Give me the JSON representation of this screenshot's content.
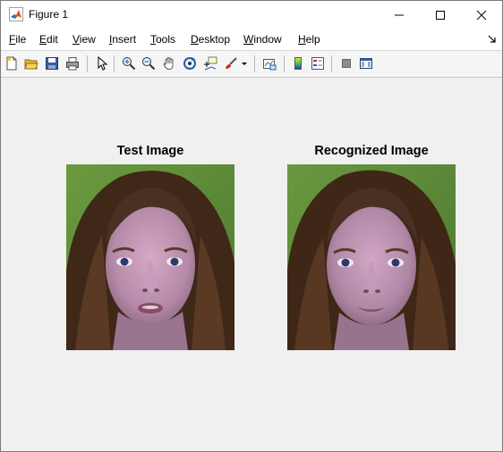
{
  "window": {
    "title": "Figure 1",
    "controls": [
      "minimize",
      "maximize",
      "close"
    ]
  },
  "menubar": {
    "items": [
      "File",
      "Edit",
      "View",
      "Insert",
      "Tools",
      "Desktop",
      "Window",
      "Help"
    ]
  },
  "toolbar": {
    "buttons": [
      {
        "icon": "new-figure-icon"
      },
      {
        "icon": "open-file-icon"
      },
      {
        "icon": "save-icon"
      },
      {
        "icon": "print-icon"
      },
      {
        "icon": "edit-plot-arrow-icon"
      },
      {
        "icon": "zoom-in-icon"
      },
      {
        "icon": "zoom-out-icon"
      },
      {
        "icon": "pan-hand-icon"
      },
      {
        "icon": "rotate-3d-icon"
      },
      {
        "icon": "data-cursor-icon"
      },
      {
        "icon": "brush-icon"
      },
      {
        "icon": "link-plot-icon"
      },
      {
        "icon": "insert-colorbar-icon"
      },
      {
        "icon": "insert-legend-icon"
      },
      {
        "icon": "hide-plot-tools-icon"
      },
      {
        "icon": "show-plot-tools-icon"
      }
    ]
  },
  "figure": {
    "left_title": "Test Image",
    "right_title": "Recognized Image"
  },
  "colors": {
    "background": "#f0f0f0",
    "image_background_green": "#5e8b3a",
    "hair_brown": "#4a3022",
    "skin_tone": "#c49ab8"
  }
}
